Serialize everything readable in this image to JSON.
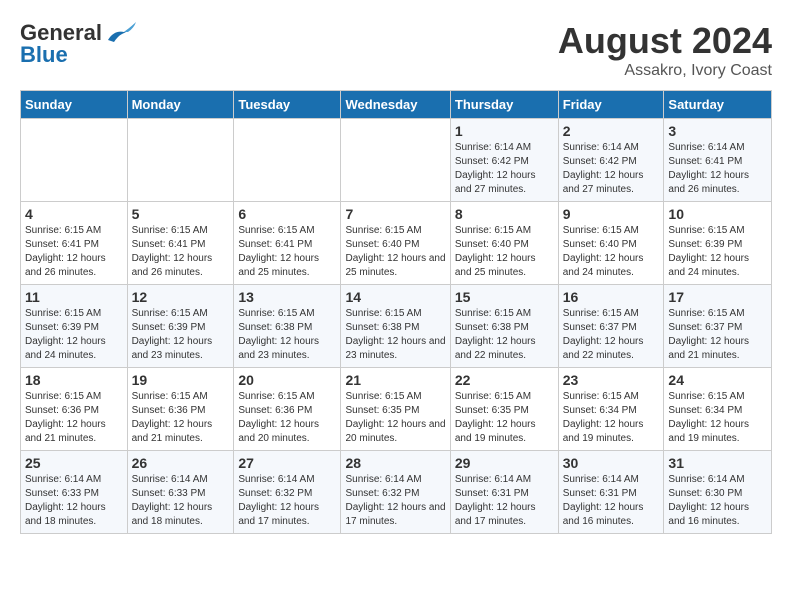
{
  "header": {
    "logo_general": "General",
    "logo_blue": "Blue",
    "title": "August 2024",
    "subtitle": "Assakro, Ivory Coast"
  },
  "days_of_week": [
    "Sunday",
    "Monday",
    "Tuesday",
    "Wednesday",
    "Thursday",
    "Friday",
    "Saturday"
  ],
  "weeks": [
    [
      {
        "day": "",
        "info": ""
      },
      {
        "day": "",
        "info": ""
      },
      {
        "day": "",
        "info": ""
      },
      {
        "day": "",
        "info": ""
      },
      {
        "day": "1",
        "info": "Sunrise: 6:14 AM\nSunset: 6:42 PM\nDaylight: 12 hours and 27 minutes."
      },
      {
        "day": "2",
        "info": "Sunrise: 6:14 AM\nSunset: 6:42 PM\nDaylight: 12 hours and 27 minutes."
      },
      {
        "day": "3",
        "info": "Sunrise: 6:14 AM\nSunset: 6:41 PM\nDaylight: 12 hours and 26 minutes."
      }
    ],
    [
      {
        "day": "4",
        "info": "Sunrise: 6:15 AM\nSunset: 6:41 PM\nDaylight: 12 hours and 26 minutes."
      },
      {
        "day": "5",
        "info": "Sunrise: 6:15 AM\nSunset: 6:41 PM\nDaylight: 12 hours and 26 minutes."
      },
      {
        "day": "6",
        "info": "Sunrise: 6:15 AM\nSunset: 6:41 PM\nDaylight: 12 hours and 25 minutes."
      },
      {
        "day": "7",
        "info": "Sunrise: 6:15 AM\nSunset: 6:40 PM\nDaylight: 12 hours and 25 minutes."
      },
      {
        "day": "8",
        "info": "Sunrise: 6:15 AM\nSunset: 6:40 PM\nDaylight: 12 hours and 25 minutes."
      },
      {
        "day": "9",
        "info": "Sunrise: 6:15 AM\nSunset: 6:40 PM\nDaylight: 12 hours and 24 minutes."
      },
      {
        "day": "10",
        "info": "Sunrise: 6:15 AM\nSunset: 6:39 PM\nDaylight: 12 hours and 24 minutes."
      }
    ],
    [
      {
        "day": "11",
        "info": "Sunrise: 6:15 AM\nSunset: 6:39 PM\nDaylight: 12 hours and 24 minutes."
      },
      {
        "day": "12",
        "info": "Sunrise: 6:15 AM\nSunset: 6:39 PM\nDaylight: 12 hours and 23 minutes."
      },
      {
        "day": "13",
        "info": "Sunrise: 6:15 AM\nSunset: 6:38 PM\nDaylight: 12 hours and 23 minutes."
      },
      {
        "day": "14",
        "info": "Sunrise: 6:15 AM\nSunset: 6:38 PM\nDaylight: 12 hours and 23 minutes."
      },
      {
        "day": "15",
        "info": "Sunrise: 6:15 AM\nSunset: 6:38 PM\nDaylight: 12 hours and 22 minutes."
      },
      {
        "day": "16",
        "info": "Sunrise: 6:15 AM\nSunset: 6:37 PM\nDaylight: 12 hours and 22 minutes."
      },
      {
        "day": "17",
        "info": "Sunrise: 6:15 AM\nSunset: 6:37 PM\nDaylight: 12 hours and 21 minutes."
      }
    ],
    [
      {
        "day": "18",
        "info": "Sunrise: 6:15 AM\nSunset: 6:36 PM\nDaylight: 12 hours and 21 minutes."
      },
      {
        "day": "19",
        "info": "Sunrise: 6:15 AM\nSunset: 6:36 PM\nDaylight: 12 hours and 21 minutes."
      },
      {
        "day": "20",
        "info": "Sunrise: 6:15 AM\nSunset: 6:36 PM\nDaylight: 12 hours and 20 minutes."
      },
      {
        "day": "21",
        "info": "Sunrise: 6:15 AM\nSunset: 6:35 PM\nDaylight: 12 hours and 20 minutes."
      },
      {
        "day": "22",
        "info": "Sunrise: 6:15 AM\nSunset: 6:35 PM\nDaylight: 12 hours and 19 minutes."
      },
      {
        "day": "23",
        "info": "Sunrise: 6:15 AM\nSunset: 6:34 PM\nDaylight: 12 hours and 19 minutes."
      },
      {
        "day": "24",
        "info": "Sunrise: 6:15 AM\nSunset: 6:34 PM\nDaylight: 12 hours and 19 minutes."
      }
    ],
    [
      {
        "day": "25",
        "info": "Sunrise: 6:14 AM\nSunset: 6:33 PM\nDaylight: 12 hours and 18 minutes."
      },
      {
        "day": "26",
        "info": "Sunrise: 6:14 AM\nSunset: 6:33 PM\nDaylight: 12 hours and 18 minutes."
      },
      {
        "day": "27",
        "info": "Sunrise: 6:14 AM\nSunset: 6:32 PM\nDaylight: 12 hours and 17 minutes."
      },
      {
        "day": "28",
        "info": "Sunrise: 6:14 AM\nSunset: 6:32 PM\nDaylight: 12 hours and 17 minutes."
      },
      {
        "day": "29",
        "info": "Sunrise: 6:14 AM\nSunset: 6:31 PM\nDaylight: 12 hours and 17 minutes."
      },
      {
        "day": "30",
        "info": "Sunrise: 6:14 AM\nSunset: 6:31 PM\nDaylight: 12 hours and 16 minutes."
      },
      {
        "day": "31",
        "info": "Sunrise: 6:14 AM\nSunset: 6:30 PM\nDaylight: 12 hours and 16 minutes."
      }
    ]
  ]
}
